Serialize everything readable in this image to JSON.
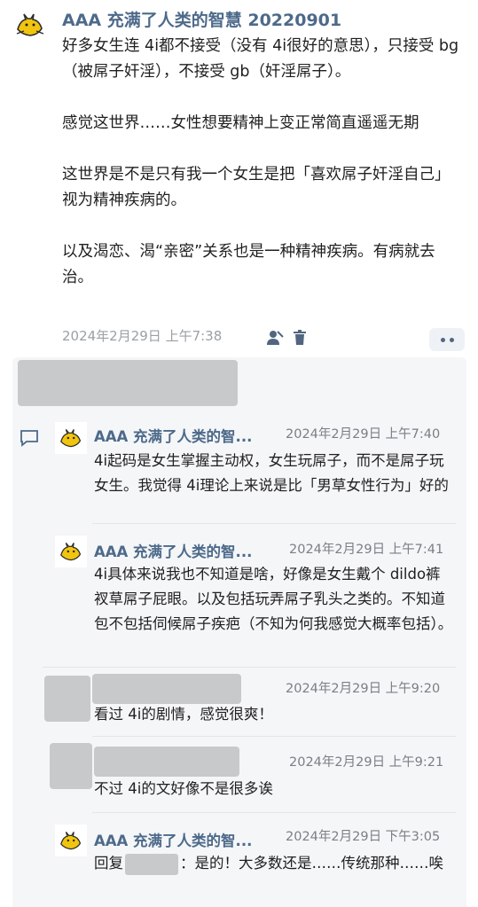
{
  "post": {
    "title": "AAA 充满了人类的智慧 20220901",
    "body": [
      "好多女生连 4i都不接受（没有 4i很好的意思），只接受 bg（被屌子奸淫），不接受 gb（奸淫屌子）。",
      "感觉这世界……女性想要精神上变正常简直遥遥无期",
      "这世界是不是只有我一个女生是把「喜欢屌子奸淫自己」视为精神疾病的。",
      "以及渴恋、渴“亲密”关系也是一种精神疾病。有病就去治。"
    ],
    "timestamp": "2024年2月29日 上午7:38",
    "icons": [
      "user-icon",
      "trash-icon",
      "more-icon"
    ]
  },
  "comments": [
    {
      "author": "AAA 充满了人类的智...",
      "time": "2024年2月29日 上午7:40",
      "text": "4i起码是女生掌握主动权，女生玩屌子，而不是屌子玩女生。我觉得 4i理论上来说是比「男草女性行为」好的"
    },
    {
      "author": "AAA 充满了人类的智...",
      "time": "2024年2月29日 上午7:41",
      "text": "4i具体来说我也不知道是啥，好像是女生戴个 dildo裤衩草屌子屁眼。以及包括玩弄屌子乳头之类的。不知道包不包括伺候屌子疾疤（不知为何我感觉大概率包括）。"
    },
    {
      "author": "",
      "time": "2024年2月29日 上午9:20",
      "text": "看过 4i的剧情，感觉很爽！"
    },
    {
      "author": "",
      "time": "2024年2月29日 上午9:21",
      "text": "不过 4i的文好像不是很多诶"
    },
    {
      "author": "AAA 充满了人类的智...",
      "time": "2024年2月29日 下午3:05",
      "reply_prefix": "回复",
      "text": "：是的！大多数还是……传统那种……唉"
    }
  ]
}
